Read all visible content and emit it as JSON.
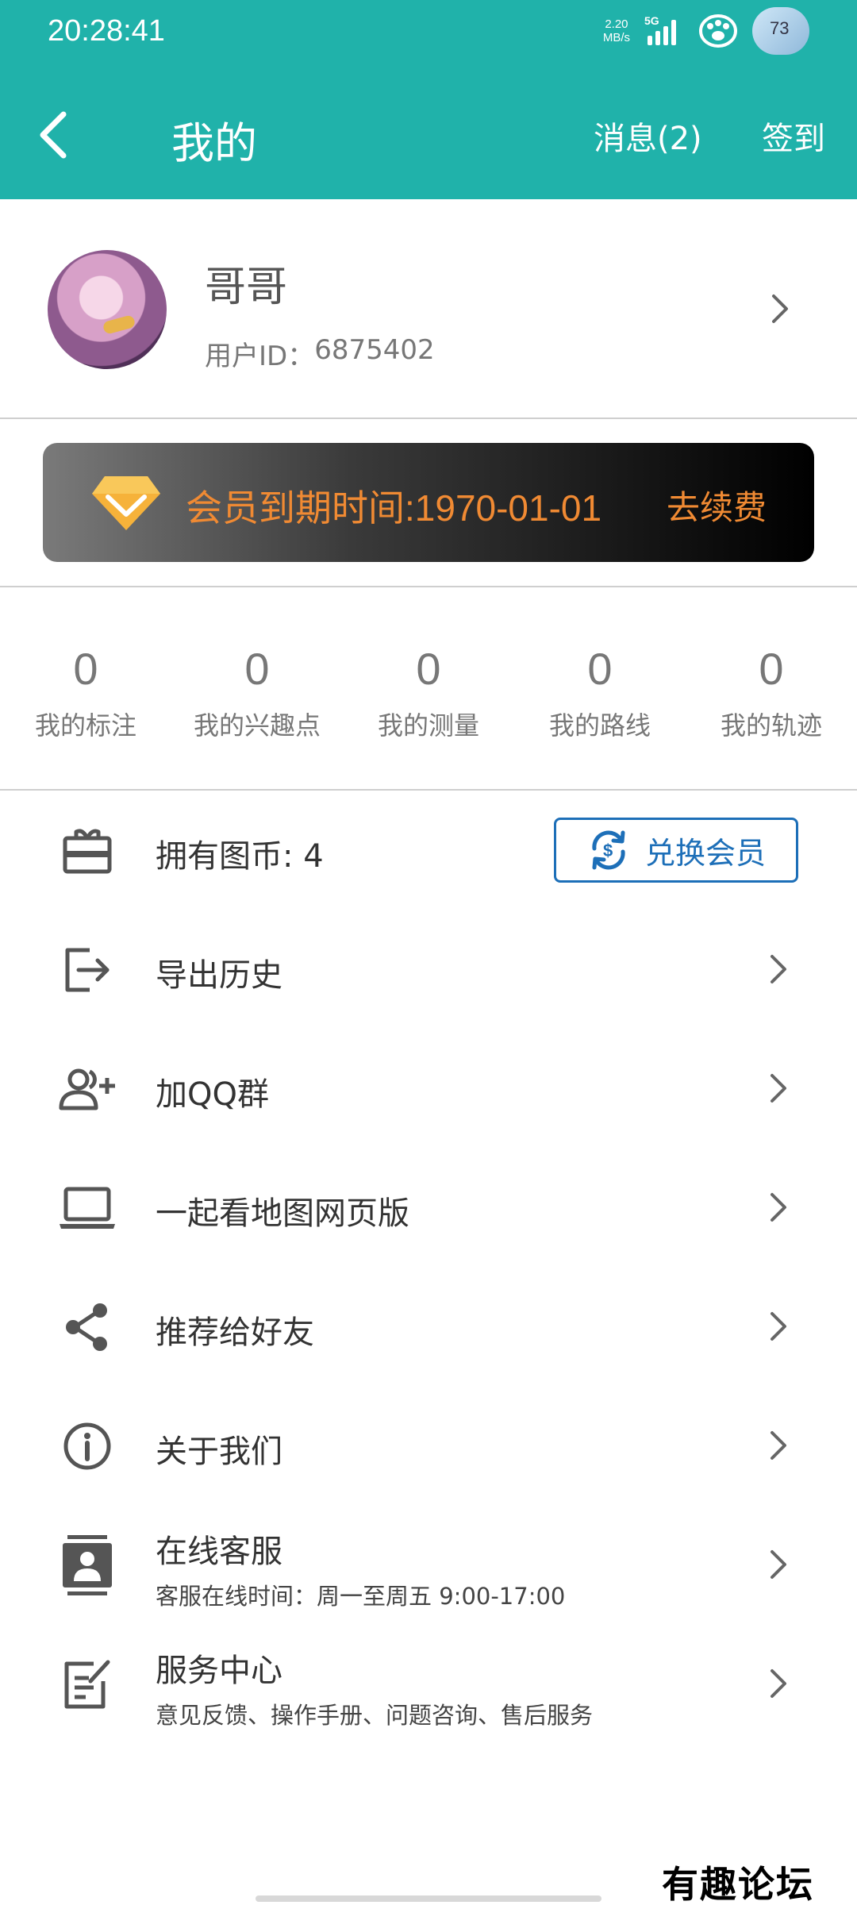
{
  "status_bar": {
    "time": "20:28:41",
    "net_speed_value": "2.20",
    "net_speed_unit": "MB/s",
    "signal_label": "5G",
    "avatar_badge": "73"
  },
  "header": {
    "title": "我的",
    "messages_label": "消息(2)",
    "signin_label": "签到",
    "bg_color": "#20b2aa"
  },
  "profile": {
    "name": "哥哥",
    "id_label": "用户ID：",
    "id_value": "6875402"
  },
  "membership": {
    "expiry_text": "会员到期时间:1970-01-01",
    "renew_label": "去续费",
    "accent_color": "#f08a33"
  },
  "stats": [
    {
      "value": "0",
      "label": "我的标注"
    },
    {
      "value": "0",
      "label": "我的兴趣点"
    },
    {
      "value": "0",
      "label": "我的测量"
    },
    {
      "value": "0",
      "label": "我的路线"
    },
    {
      "value": "0",
      "label": "我的轨迹"
    }
  ],
  "coins": {
    "label": "拥有图币: 4",
    "exchange_label": "兑换会员",
    "icon": "gift-card-icon"
  },
  "menu": [
    {
      "label": "导出历史",
      "icon": "export-icon"
    },
    {
      "label": "加QQ群",
      "icon": "add-group-icon"
    },
    {
      "label": "一起看地图网页版",
      "icon": "laptop-icon"
    },
    {
      "label": "推荐给好友",
      "icon": "share-icon"
    },
    {
      "label": "关于我们",
      "icon": "info-icon"
    },
    {
      "label": "在线客服",
      "sub": "客服在线时间：周一至周五 9:00-17:00",
      "icon": "contact-card-icon"
    },
    {
      "label": "服务中心",
      "sub": "意见反馈、操作手册、问题咨询、售后服务",
      "icon": "feedback-icon"
    }
  ],
  "watermark": "有趣论坛"
}
